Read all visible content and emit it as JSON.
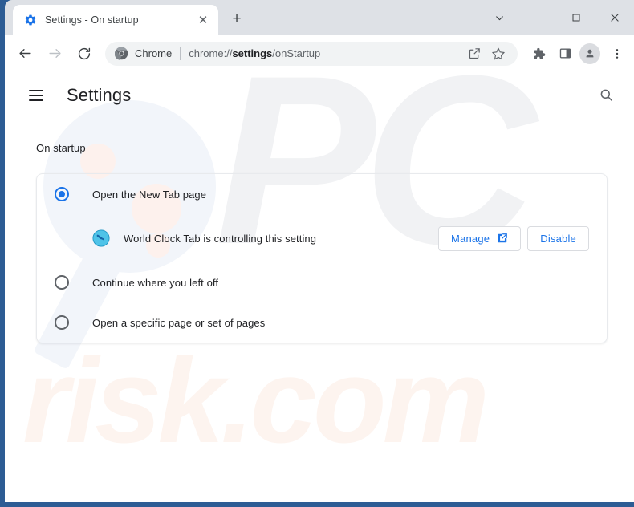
{
  "window": {
    "controls": {
      "tab_search_label": "Search tabs",
      "minimize_label": "Minimize",
      "maximize_label": "Maximize",
      "close_label": "Close"
    }
  },
  "tabstrip": {
    "tab_title": "Settings - On startup",
    "tab_close_glyph": "✕",
    "favicon_name": "gear-icon",
    "new_tab_glyph": "+"
  },
  "toolbar": {
    "back_label": "Back",
    "forward_label": "Forward",
    "reload_label": "Reload",
    "omnibox": {
      "chrome_icon_name": "chrome-logo-icon",
      "scheme_label": "Chrome",
      "url_prefix": "chrome://",
      "url_bold": "settings",
      "url_suffix": "/onStartup",
      "share_icon_name": "share-icon",
      "bookmark_icon_name": "star-icon"
    },
    "extensions_icon_name": "puzzle-piece-icon",
    "side_panel_icon_name": "side-panel-icon",
    "profile_icon_name": "person-avatar-icon",
    "menu_icon_name": "three-dot-menu-icon"
  },
  "settings": {
    "menu_icon_name": "hamburger-menu-icon",
    "title": "Settings",
    "search_icon_name": "search-icon",
    "section_heading": "On startup",
    "options": [
      {
        "label": "Open the New Tab page",
        "selected": true
      },
      {
        "label": "Continue where you left off",
        "selected": false
      },
      {
        "label": "Open a specific page or set of pages",
        "selected": false
      }
    ],
    "extension_notice": {
      "icon_name": "world-clock-tab-icon",
      "text": "World Clock Tab is controlling this setting",
      "manage_button": "Manage",
      "manage_icon_name": "external-link-icon",
      "disable_button": "Disable"
    }
  },
  "watermark": {
    "letters": "PC",
    "domain": "risk.com"
  },
  "colors": {
    "accent": "#1a73e8",
    "frame": "#2d5c94",
    "tabstrip": "#dee1e6",
    "omnibox": "#f1f3f4",
    "text": "#202124",
    "text_secondary": "#5f6368",
    "border": "#dadce0"
  }
}
